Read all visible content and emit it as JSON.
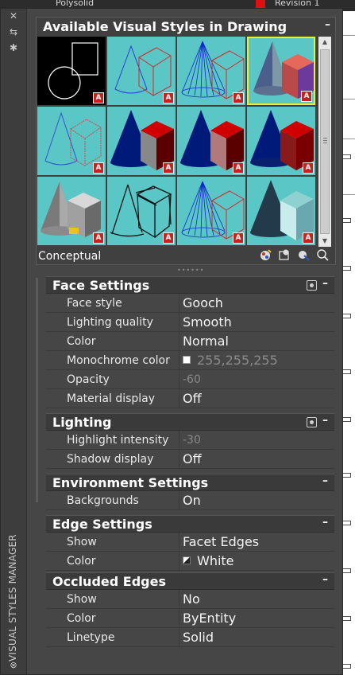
{
  "background_app": {
    "polysolid_label": "Polysolid",
    "revision_label": "Revision 1"
  },
  "palette": {
    "vertical_title": "VISUAL STYLES MANAGER",
    "close_glyph": "✕",
    "pin_glyph": "⇆",
    "properties_glyph": "✱"
  },
  "styles_panel": {
    "title": "Available Visual Styles in Drawing",
    "collapse_glyph": "–",
    "current_style": "Conceptual",
    "thumbnails": [
      {
        "icon": "2d-wireframe-thumbnail"
      },
      {
        "icon": "wireframe-thumbnail"
      },
      {
        "icon": "hidden-thumbnail"
      },
      {
        "icon": "conceptual-thumbnail",
        "selected": true
      },
      {
        "icon": "realistic-thumbnail"
      },
      {
        "icon": "shaded-thumbnail"
      },
      {
        "icon": "shaded-with-edges-thumbnail"
      },
      {
        "icon": "shades-of-gray-thumbnail"
      },
      {
        "icon": "sketchy-thumbnail"
      },
      {
        "icon": "x-ray-thumbnail"
      },
      {
        "icon": "blue-wireframe-thumbnail"
      },
      {
        "icon": "dotted-thumbnail"
      }
    ],
    "tools": [
      "create-visual-style-icon",
      "apply-to-viewport-icon",
      "export-to-tool-palette-icon",
      "delete-visual-style-icon"
    ]
  },
  "sections": {
    "face": {
      "title": "Face Settings",
      "collapse_glyph": "–",
      "rows": [
        {
          "name": "Face style",
          "value": "Gooch"
        },
        {
          "name": "Lighting quality",
          "value": "Smooth"
        },
        {
          "name": "Color",
          "value": "Normal"
        },
        {
          "name": "Monochrome color",
          "value": "255,255,255"
        },
        {
          "name": "Opacity",
          "value": "-60"
        },
        {
          "name": "Material display",
          "value": "Off"
        }
      ]
    },
    "lighting": {
      "title": "Lighting",
      "collapse_glyph": "–",
      "rows": [
        {
          "name": "Highlight intensity",
          "value": "-30"
        },
        {
          "name": "Shadow display",
          "value": "Off"
        }
      ]
    },
    "environment": {
      "title": "Environment Settings",
      "collapse_glyph": "–",
      "rows": [
        {
          "name": "Backgrounds",
          "value": "On"
        }
      ]
    },
    "edge": {
      "title": "Edge Settings",
      "collapse_glyph": "–",
      "rows": [
        {
          "name": "Show",
          "value": "Facet Edges"
        },
        {
          "name": "Color",
          "value": "White"
        }
      ]
    },
    "occluded": {
      "title": "Occluded Edges",
      "collapse_glyph": "–",
      "rows": [
        {
          "name": "Show",
          "value": "No"
        },
        {
          "name": "Color",
          "value": "ByEntity"
        },
        {
          "name": "Linetype",
          "value": "Solid"
        }
      ]
    }
  },
  "colors": {
    "thumbnail_bg": "#5ac6c6",
    "selection": "#e6ef3c",
    "panel_bg": "#464646",
    "accent_red": "#c9201d"
  }
}
